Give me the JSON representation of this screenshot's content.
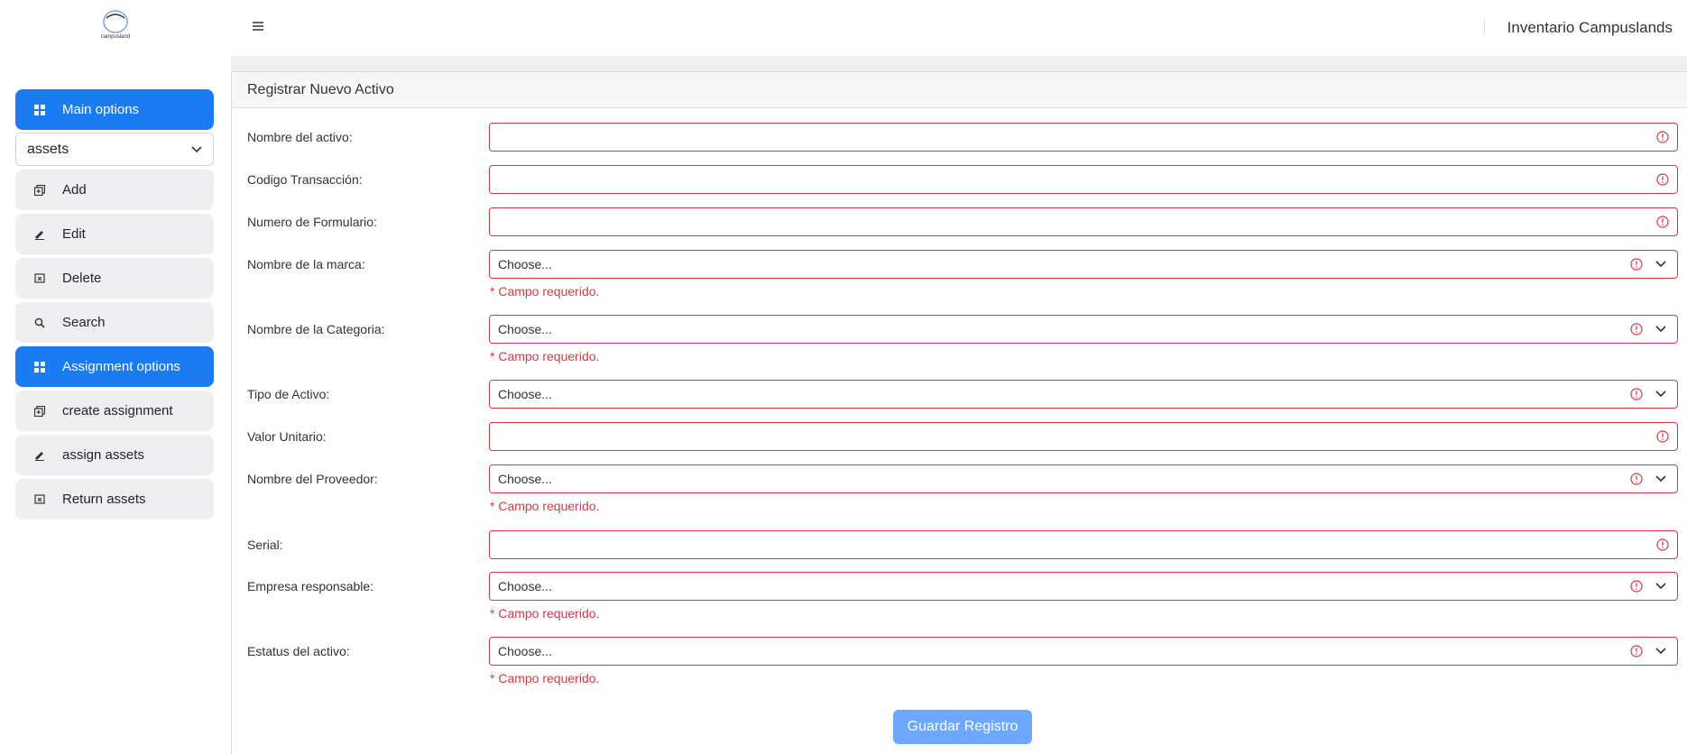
{
  "app": {
    "title": "Inventario Campuslands",
    "logo_text": "campusland"
  },
  "sidebar": {
    "main_options": "Main options",
    "selected_module": "assets",
    "items": [
      {
        "label": "Add",
        "icon": "add-copy-icon"
      },
      {
        "label": "Edit",
        "icon": "pencil-icon"
      },
      {
        "label": "Delete",
        "icon": "trash-box-icon"
      },
      {
        "label": "Search",
        "icon": "search-icon"
      }
    ],
    "assignment_options": "Assignment options",
    "assignment_items": [
      {
        "label": "create assignment",
        "icon": "add-copy-icon"
      },
      {
        "label": "assign assets",
        "icon": "pencil-icon"
      },
      {
        "label": "Return assets",
        "icon": "trash-box-icon"
      }
    ]
  },
  "form": {
    "title": "Registrar Nuevo Activo",
    "required_msg": "* Campo requerido.",
    "placeholder_choose": "Choose...",
    "fields": {
      "nombre_activo": "Nombre del activo:",
      "codigo": "Codigo Transacción:",
      "formulario": "Numero de Formulario:",
      "marca": "Nombre de la marca:",
      "categoria": "Nombre de la Categoria:",
      "tipo": "Tipo de Activo:",
      "valor": "Valor Unitario:",
      "proveedor": "Nombre del Proveedor:",
      "serial": "Serial:",
      "empresa": "Empresa responsable:",
      "estatus": "Estatus del activo:"
    },
    "submit": "Guardar Registro"
  },
  "colors": {
    "accent": "#1b7cf2",
    "error": "#dc3545",
    "button": "#6ea8fe"
  }
}
